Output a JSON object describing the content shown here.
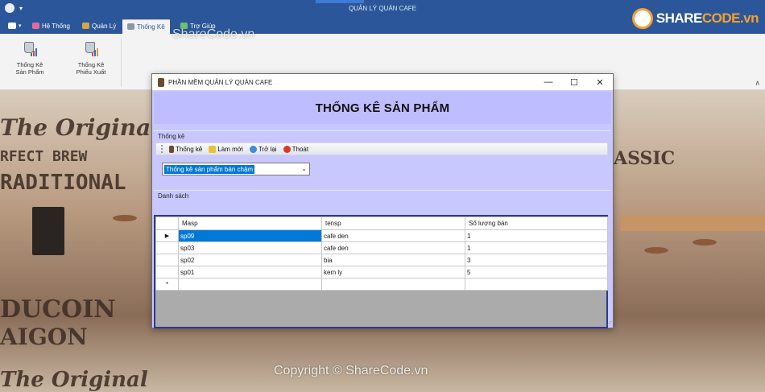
{
  "app": {
    "title": "QUẢN LÝ QUÁN CAFE",
    "tabs": [
      {
        "label": "Hệ Thống",
        "icon": "system-icon"
      },
      {
        "label": "Quản Lý",
        "icon": "manage-icon"
      },
      {
        "label": "Thống Kê",
        "icon": "statistics-icon",
        "selected": true
      },
      {
        "label": "Trợ Giúp",
        "icon": "help-icon"
      }
    ],
    "ribbon_buttons": [
      {
        "label_line1": "Thống Kê",
        "label_line2": "Sản Phẩm"
      },
      {
        "label_line1": "Thống Kê",
        "label_line2": "Phiếu Xuất"
      }
    ]
  },
  "watermark": {
    "top": "ShareCode.vn",
    "bottom": "Copyright © ShareCode.vn",
    "logo_left": "SHARE",
    "logo_right": "CODE.vn"
  },
  "background_text": {
    "w1": "The Original",
    "w2": "RFECT BREW",
    "w3": "RADITIONAL",
    "w4": "DUCOIN",
    "w5": "AIGON",
    "w6": "The Original",
    "w7": "ASSIC"
  },
  "dialog": {
    "title": "PHẦN MỀM QUẢN LÝ QUÁN CAFE",
    "header": "THỐNG KÊ SẢN PHẨM",
    "group1_label": "Thống kê",
    "toolbar": {
      "stats": "Thống kê",
      "refresh": "Làm mới",
      "back": "Trở lại",
      "exit": "Thoát"
    },
    "combo_value": "Thống kê sản phẩm bán chậm",
    "group2_label": "Danh sách",
    "columns": [
      "Masp",
      "tensp",
      "Số lượng bán"
    ],
    "rows": [
      {
        "masp": "sp09",
        "tensp": "cafe den",
        "qty": "1"
      },
      {
        "masp": "sp03",
        "tensp": "cafe den",
        "qty": "1"
      },
      {
        "masp": "sp02",
        "tensp": "bia",
        "qty": "3"
      },
      {
        "masp": "sp01",
        "tensp": "kem ly",
        "qty": "5"
      }
    ],
    "current_row_marker": "▶",
    "new_row_marker": "*"
  },
  "colors": {
    "title_blue": "#2b579a",
    "dialog_bg": "#c8c8ff",
    "selection": "#0078d7"
  }
}
